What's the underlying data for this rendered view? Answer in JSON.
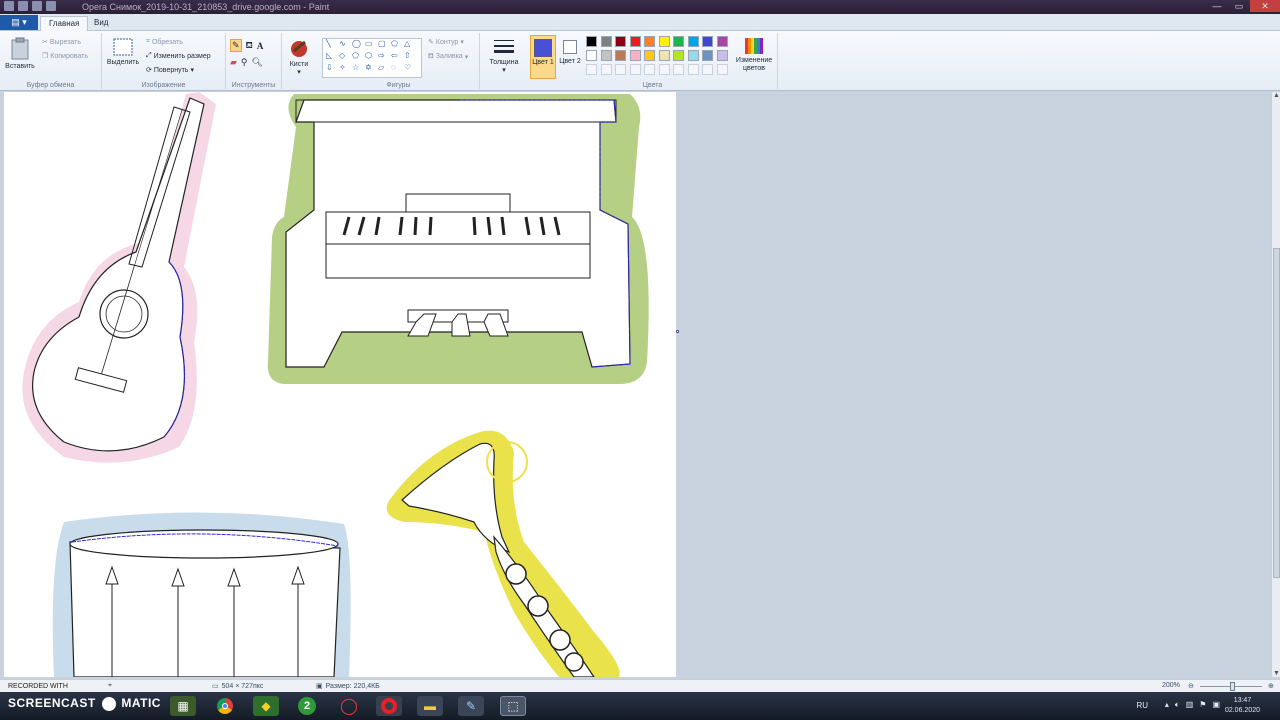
{
  "window": {
    "title": "Opera Снимок_2019-10-31_210853_drive.google.com - Paint"
  },
  "tabs": {
    "file_label": "",
    "home": "Главная",
    "view": "Вид"
  },
  "ribbon": {
    "clipboard": {
      "label": "Буфер обмена",
      "paste": "Вставить",
      "cut": "Вырезать",
      "copy": "Копировать"
    },
    "image": {
      "label": "Изображение",
      "select": "Выделить",
      "crop": "Обрезать",
      "resize": "Изменить размер",
      "rotate": "Повернуть"
    },
    "tools": {
      "label": "Инструменты",
      "brushes": "Кисти"
    },
    "shapes": {
      "label": "Фигуры",
      "outline": "Контур",
      "fill": "Заливка"
    },
    "thickness": "Толщина",
    "colors": {
      "label": "Цвета",
      "color1": "Цвет 1",
      "color2": "Цвет 2",
      "edit": "Изменение цветов",
      "color1_value": "#4a4fd8",
      "color2_value": "#ffffff",
      "palette_row1": [
        "#000000",
        "#7f7f7f",
        "#880015",
        "#ed1c24",
        "#ff7f27",
        "#fff200",
        "#22b14c",
        "#00a2e8",
        "#3f48cc",
        "#a349a4"
      ],
      "palette_row2": [
        "#ffffff",
        "#c3c3c3",
        "#b97a57",
        "#ffaec9",
        "#ffc90e",
        "#efe4b0",
        "#b5e61d",
        "#99d9ea",
        "#7092be",
        "#c8bfe7"
      ]
    }
  },
  "status": {
    "dimensions": "504 × 727пкс",
    "size": "Размер: 220,4КБ",
    "zoom": "200%"
  },
  "taskbar": {
    "recorded_with": "RECORDED WITH",
    "watermark": "SCREENCAST",
    "watermark2": "MATIC",
    "lang": "RU",
    "time": "13:47",
    "date": "02.06.2020"
  }
}
